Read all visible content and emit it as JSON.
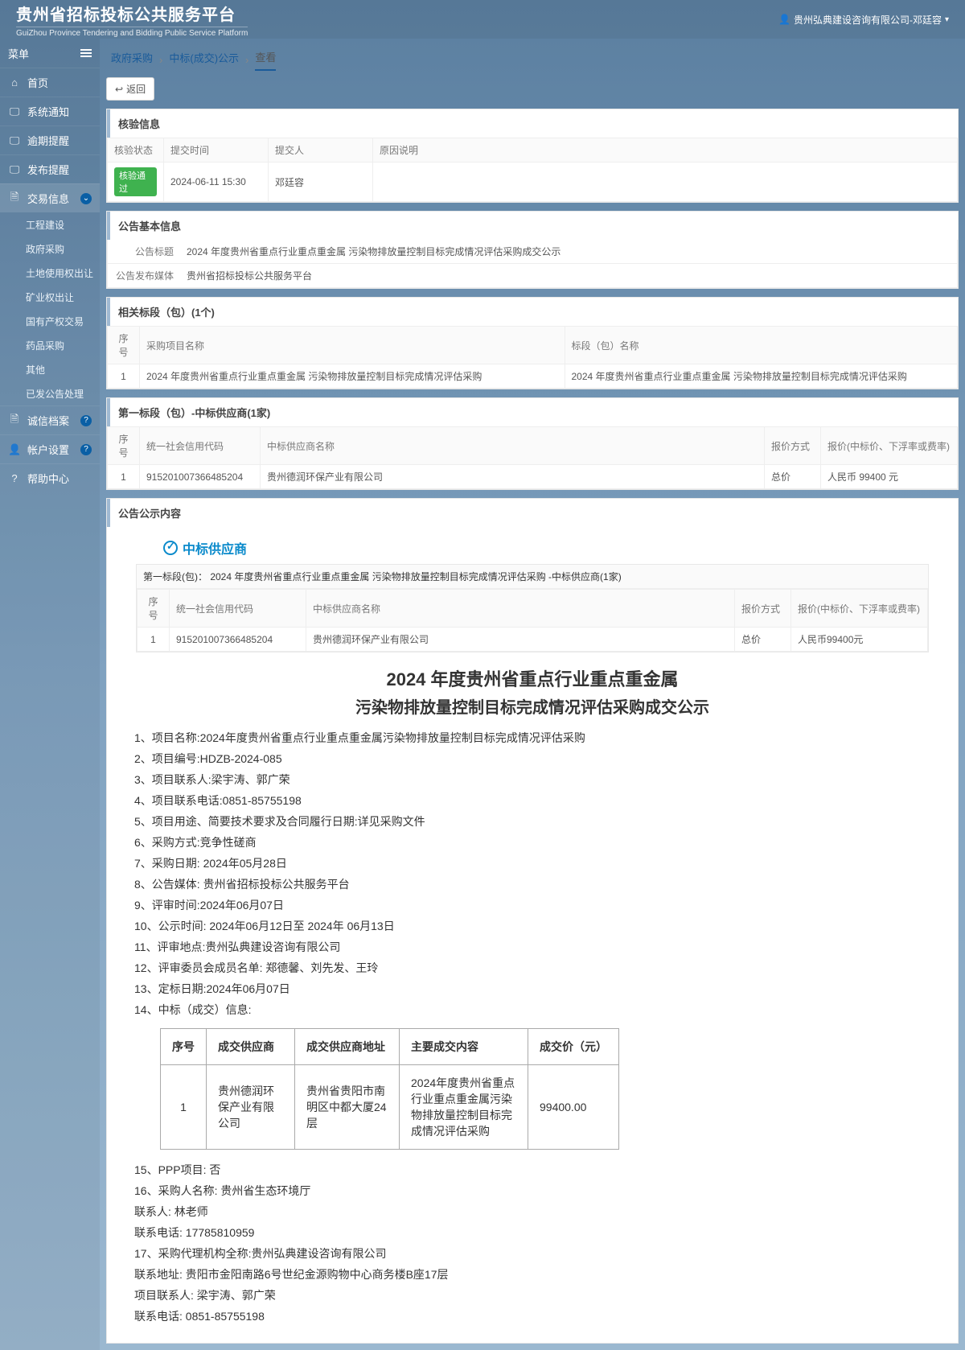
{
  "header": {
    "title": "贵州省招标投标公共服务平台",
    "subtitle": "GuiZhou Province Tendering and Bidding Public Service Platform",
    "user": "贵州弘典建设咨询有限公司-邓廷容"
  },
  "sidebar": {
    "menu_label": "菜单",
    "items": [
      {
        "icon": "⌂",
        "label": "首页",
        "chev": false
      },
      {
        "icon": "🖵",
        "label": "系统通知",
        "chev": false
      },
      {
        "icon": "🖵",
        "label": "逾期提醒",
        "chev": false
      },
      {
        "icon": "🖵",
        "label": "发布提醒",
        "chev": false
      },
      {
        "icon": "🗎",
        "label": "交易信息",
        "chev": true,
        "active": true,
        "dot": "⌄"
      }
    ],
    "sub_items": [
      "工程建设",
      "政府采购",
      "土地使用权出让",
      "矿业权出让",
      "国有产权交易",
      "药品采购",
      "其他",
      "已发公告处理"
    ],
    "tail_items": [
      {
        "icon": "🗎",
        "label": "诚信档案",
        "badge": "?"
      },
      {
        "icon": "👤",
        "label": "帐户设置",
        "badge": "?"
      },
      {
        "icon": "?",
        "label": "帮助中心"
      }
    ]
  },
  "crumbs": {
    "a": "政府采购",
    "b": "中标(成交)公示",
    "c": "查看"
  },
  "back_label": "返回",
  "panels": {
    "verify_title": "核验信息",
    "verify_headers": [
      "核验状态",
      "提交时间",
      "提交人",
      "原因说明"
    ],
    "verify_row": {
      "status": "核验通过",
      "time": "2024-06-11 15:30",
      "person": "邓廷容",
      "reason": ""
    },
    "base_title": "公告基本信息",
    "base_rows": [
      {
        "label": "公告标题",
        "value": "2024 年度贵州省重点行业重点重金属 污染物排放量控制目标完成情况评估采购成交公示"
      },
      {
        "label": "公告发布媒体",
        "value": "贵州省招标投标公共服务平台"
      }
    ],
    "lot_title": "相关标段（包）(1个)",
    "lot_headers": [
      "序号",
      "采购项目名称",
      "标段（包）名称"
    ],
    "lot_row": {
      "idx": "1",
      "proj": "2024 年度贵州省重点行业重点重金属 污染物排放量控制目标完成情况评估采购",
      "name": "2024 年度贵州省重点行业重点重金属 污染物排放量控制目标完成情况评估采购"
    },
    "sup_title": "第一标段（包）-中标供应商(1家)",
    "sup_headers": [
      "序号",
      "统一社会信用代码",
      "中标供应商名称",
      "报价方式",
      "报价(中标价、下浮率或费率)"
    ],
    "sup_row": {
      "idx": "1",
      "code": "915201007366485204",
      "name": "贵州德润环保产业有限公司",
      "mode": "总价",
      "price": "人民币 99400 元"
    },
    "content_title": "公告公示内容"
  },
  "ann": {
    "supplier_tag": "中标供应商",
    "inner_head": "第一标段(包)：  2024 年度贵州省重点行业重点重金属 污染物排放量控制目标完成情况评估采购 -中标供应商(1家)",
    "inner_headers": [
      "序号",
      "统一社会信用代码",
      "中标供应商名称",
      "报价方式",
      "报价(中标价、下浮率或费率)"
    ],
    "inner_row": {
      "idx": "1",
      "code": "915201007366485204",
      "name": "贵州德润环保产业有限公司",
      "mode": "总价",
      "price": "人民币99400元"
    },
    "doc_title_l1": "2024  年度贵州省重点行业重点重金属",
    "doc_title_l2": "污染物排放量控制目标完成情况评估采购成交公示",
    "lines": [
      "1、项目名称:2024年度贵州省重点行业重点重金属污染物排放量控制目标完成情况评估采购",
      "2、项目编号:HDZB-2024-085",
      "3、项目联系人:梁宇涛、郭广荣",
      "4、项目联系电话:0851-85755198",
      "5、项目用途、简要技术要求及合同履行日期:详见采购文件",
      "6、采购方式:竞争性磋商",
      "7、采购日期: 2024年05月28日",
      "8、公告媒体: 贵州省招标投标公共服务平台",
      "9、评审时间:2024年06月07日",
      "10、公示时间: 2024年06月12日至 2024年 06月13日",
      "11、评审地点:贵州弘典建设咨询有限公司",
      "12、评审委员会成员名单: 郑德馨、刘先发、王玲",
      "13、定标日期:2024年06月07日",
      "14、中标（成交）信息:"
    ],
    "deal_headers": [
      "序号",
      "成交供应商",
      "成交供应商地址",
      "主要成交内容",
      "成交价（元）"
    ],
    "deal_row": {
      "idx": "1",
      "sup": "贵州德润环保产业有限公司",
      "addr": "贵州省贵阳市南明区中都大厦24层",
      "content": "2024年度贵州省重点行业重点重金属污染物排放量控制目标完成情况评估采购",
      "price": "99400.00"
    },
    "lines2": [
      "15、PPP项目: 否",
      "16、采购人名称: 贵州省生态环境厅",
      "联系人: 林老师",
      "联系电话: 17785810959",
      "17、采购代理机构全称:贵州弘典建设咨询有限公司",
      "联系地址: 贵阳市金阳南路6号世纪金源购物中心商务楼B座17层",
      "项目联系人: 梁宇涛、郭广荣",
      "联系电话: 0851-85755198"
    ]
  }
}
